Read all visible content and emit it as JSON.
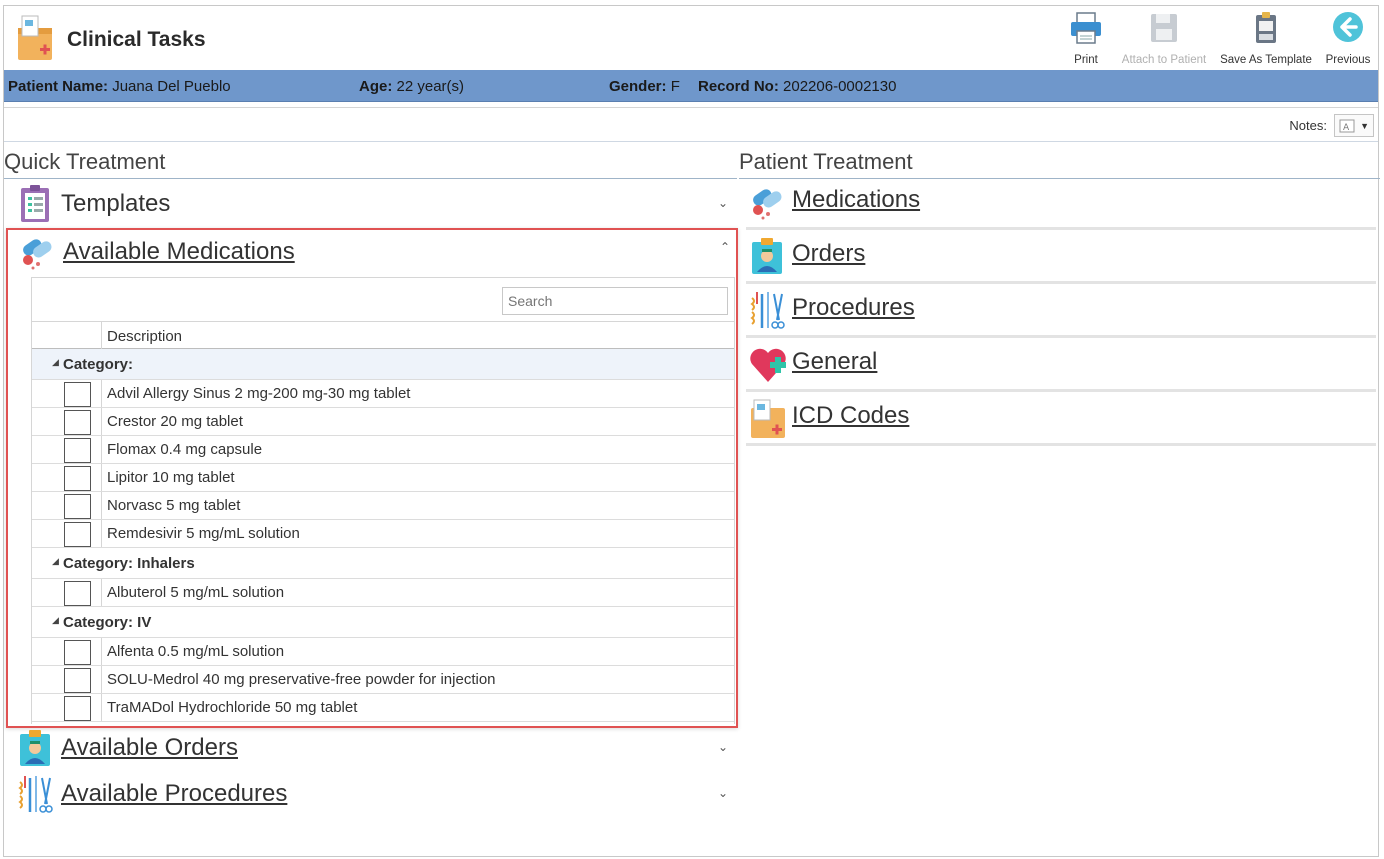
{
  "app": {
    "title": "Clinical Tasks"
  },
  "toolbar": {
    "print": "Print",
    "attach": "Attach to Patient",
    "save_template": "Save As Template",
    "previous": "Previous"
  },
  "patient": {
    "name_label": "Patient Name:",
    "name": "Juana Del Pueblo",
    "age_label": "Age:",
    "age": "22 year(s)",
    "gender_label": "Gender:",
    "gender": "F",
    "record_label": "Record No:",
    "record": "202206-0002130"
  },
  "notes": {
    "label": "Notes:"
  },
  "quick_treatment": {
    "title": "Quick Treatment",
    "templates_label": "Templates",
    "available_medications_label": "Available Medications",
    "search_placeholder": "Search",
    "description_header": "Description",
    "groups": [
      {
        "label": "Category:",
        "items": [
          "Advil Allergy Sinus 2 mg-200 mg-30 mg tablet",
          "Crestor 20 mg tablet",
          "Flomax 0.4 mg capsule",
          "Lipitor 10 mg tablet",
          "Norvasc 5 mg tablet",
          "Remdesivir 5 mg/mL solution"
        ]
      },
      {
        "label": "Category: Inhalers",
        "items": [
          "Albuterol 5 mg/mL solution"
        ]
      },
      {
        "label": "Category: IV",
        "items": [
          "Alfenta 0.5 mg/mL solution",
          "SOLU-Medrol 40 mg preservative-free powder for injection",
          "TraMADol Hydrochloride 50 mg tablet"
        ]
      }
    ],
    "available_orders_label": "Available Orders",
    "available_procedures_label": "Available Procedures"
  },
  "patient_treatment": {
    "title": "Patient Treatment",
    "items": [
      "Medications",
      "Orders",
      "Procedures",
      "General",
      "ICD Codes"
    ]
  },
  "colors": {
    "patient_bar": "#6f97cb",
    "highlight_border": "#e05252"
  }
}
